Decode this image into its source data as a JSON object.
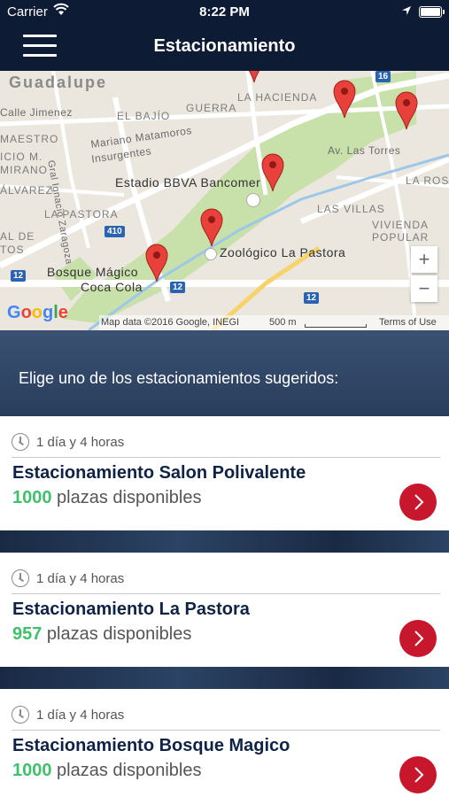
{
  "status_bar": {
    "carrier": "Carrier",
    "time": "8:22 PM"
  },
  "nav": {
    "title": "Estacionamiento"
  },
  "map": {
    "labels": {
      "guadalupe": "Guadalupe",
      "la_hacienda": "LA HACIENDA",
      "guerra": "GUERRA",
      "el_bajio": "EL BAJÍO",
      "calle_jimenez": "Calle Jimenez",
      "gral_ignacio": "Gral Ignacio Zaragoza",
      "mariano": "Mariano Matamoros",
      "insurgentes": "Insurgentes",
      "maestro": "MAESTRO",
      "ricio": "ICIO M.",
      "mirano": "MIRANO",
      "alvarez": "ÁLVAREZ",
      "la_pastora": "LA PASTORA",
      "al_de": "AL DE",
      "tos": "TOS",
      "av_las_torres": "Av. Las Torres",
      "la_ros": "LA ROS",
      "las_villas": "LAS VILLAS",
      "vivienda": "VIVIENDA",
      "popular": "POPULAR",
      "estadio": "Estadio BBVA Bancomer",
      "zoologico": "Zoológico La Pastora",
      "bosque1": "Bosque Mágico",
      "bosque2": "Coca Cola",
      "road_16": "16",
      "road_410": "410",
      "road_12a": "12",
      "road_12b": "12",
      "road_12c": "12"
    },
    "zoom_in": "+",
    "zoom_out": "−",
    "google": "Google",
    "attribution": "Map data ©2016 Google, INEGI",
    "scale": "500 m",
    "terms": "Terms of Use"
  },
  "prompt": "Elige uno de los estacionamientos sugeridos:",
  "parkings": [
    {
      "duration": "1 día y 4 horas",
      "name": "Estacionamiento Salon Polivalente",
      "count": "1000",
      "suffix": " plazas disponibles"
    },
    {
      "duration": "1 día y 4 horas",
      "name": "Estacionamiento La Pastora",
      "count": "957",
      "suffix": " plazas disponibles"
    },
    {
      "duration": "1 día y 4 horas",
      "name": "Estacionamiento Bosque Magico",
      "count": "1000",
      "suffix": " plazas disponibles"
    }
  ],
  "colors": {
    "nav": "#0d1b34",
    "accent": "#c8172d",
    "available": "#3fc06a",
    "title": "#0f2347"
  }
}
